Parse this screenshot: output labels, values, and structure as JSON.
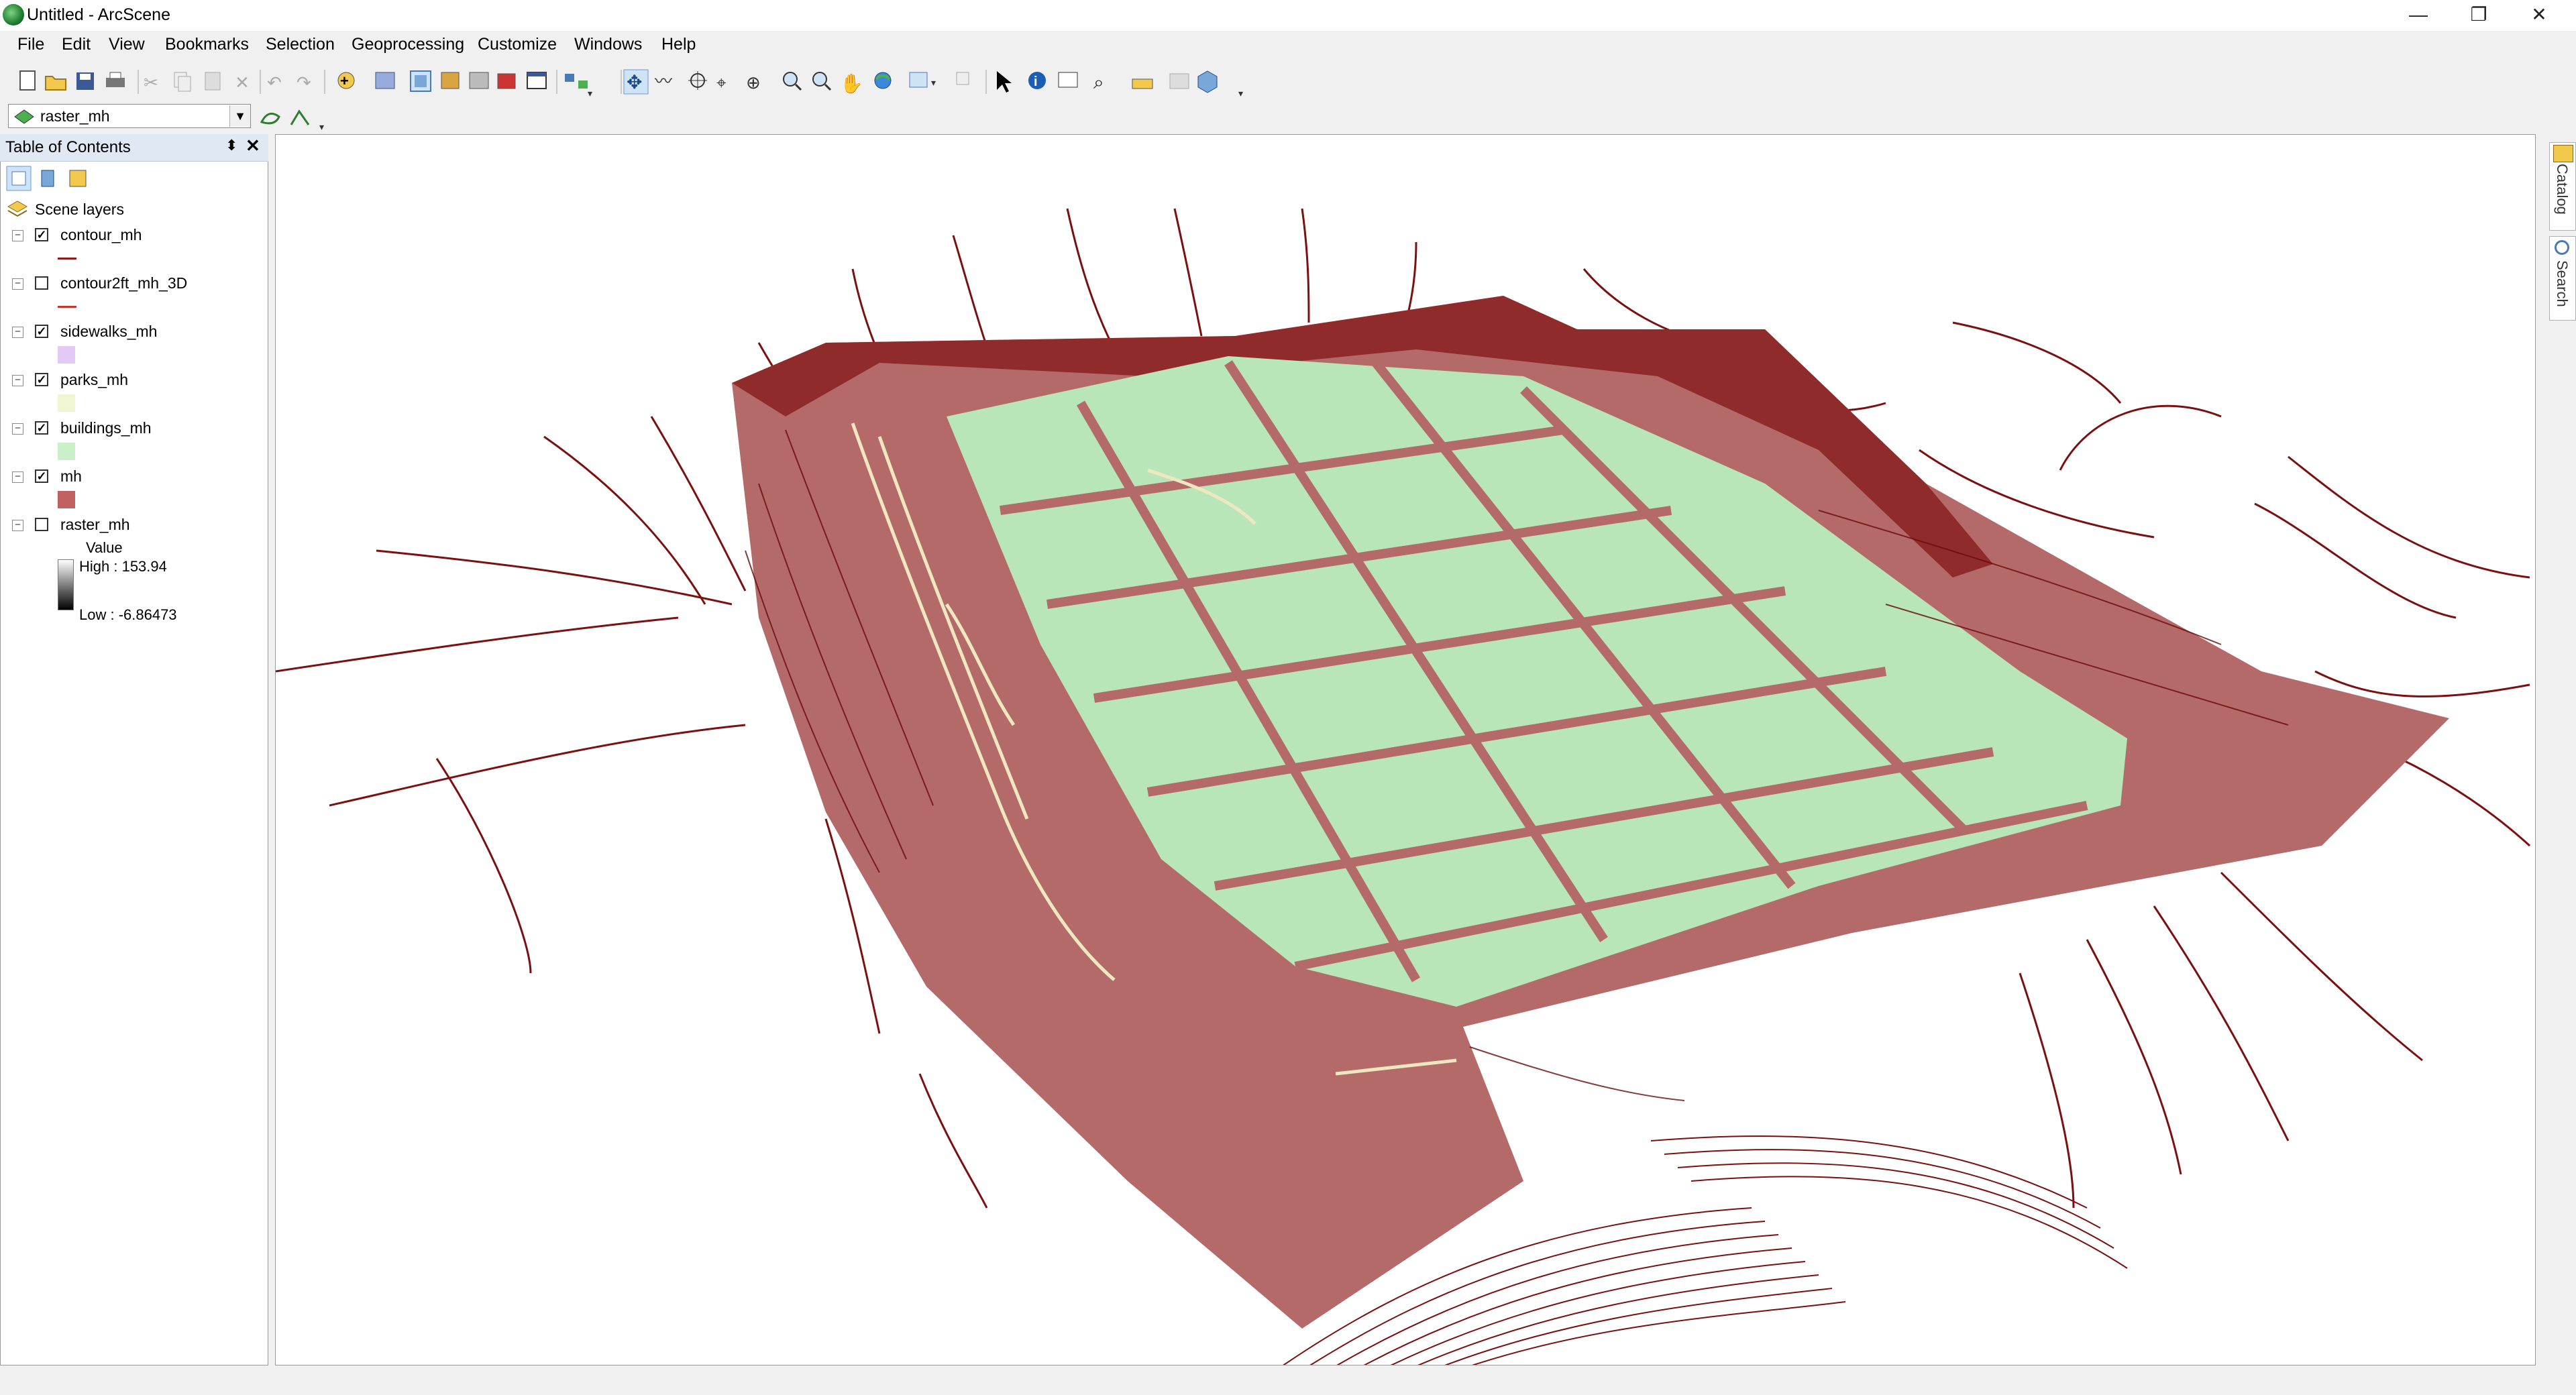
{
  "window": {
    "title": "Untitled - ArcScene",
    "controls": {
      "minimize": "—",
      "restore": "❐",
      "close": "✕"
    }
  },
  "menu": [
    "File",
    "Edit",
    "View",
    "Bookmarks",
    "Selection",
    "Geoprocessing",
    "Customize",
    "Windows",
    "Help"
  ],
  "layer_selector": {
    "value": "raster_mh"
  },
  "toc": {
    "title": "Table of Contents",
    "pin": "⬍",
    "close": "✕",
    "scene_layers_label": "Scene layers",
    "layers": [
      {
        "name": "contour_mh",
        "checked": true,
        "swatch": "line",
        "color": "#8b1a1a"
      },
      {
        "name": "contour2ft_mh_3D",
        "checked": false,
        "swatch": "line",
        "color": "#c0392b"
      },
      {
        "name": "sidewalks_mh",
        "checked": true,
        "swatch": "box",
        "color": "#e3c9f5"
      },
      {
        "name": "parks_mh",
        "checked": true,
        "swatch": "box",
        "color": "#f0f6d2"
      },
      {
        "name": "buildings_mh",
        "checked": true,
        "swatch": "box",
        "color": "#c9f0c8"
      },
      {
        "name": "mh",
        "checked": true,
        "swatch": "box",
        "color": "#c06060"
      },
      {
        "name": "raster_mh",
        "checked": false,
        "swatch": "ramp",
        "color": "#000000"
      }
    ],
    "raster_legend": {
      "field": "Value",
      "high": "High : 153.94",
      "low": "Low : -6.86473"
    }
  },
  "right_dock": {
    "tabs": [
      "Catalog",
      "Search"
    ]
  },
  "colors": {
    "terrain": "#b56a6a",
    "contour": "#7a1010",
    "buildings": "#b9e6b8",
    "parks": "#efe7bf",
    "sidewalks": "#e6dccd"
  }
}
